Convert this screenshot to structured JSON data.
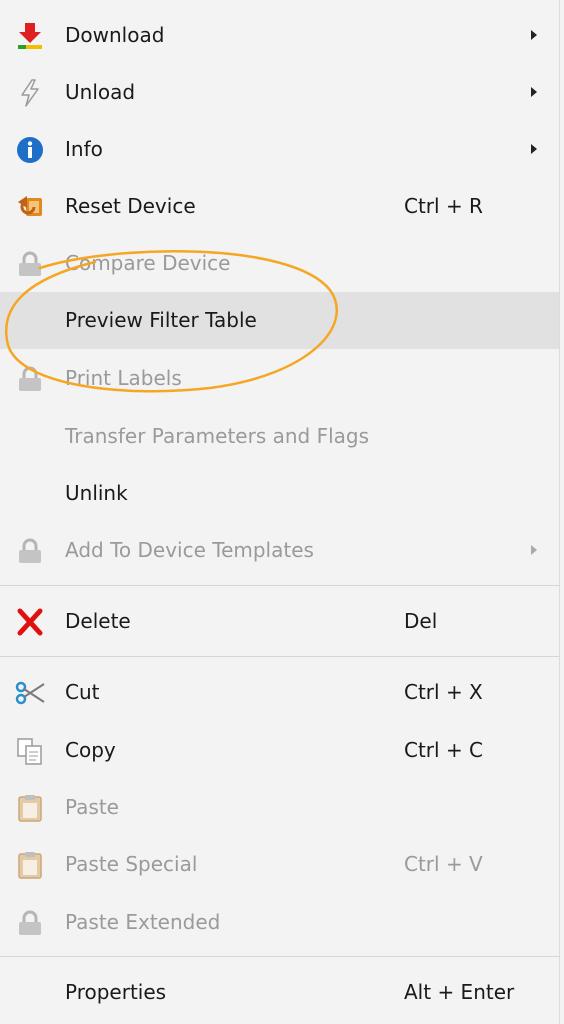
{
  "menu": {
    "items": [
      {
        "label": "Download",
        "shortcut": "",
        "icon": "download-icon",
        "submenu": true,
        "enabled": true
      },
      {
        "label": "Unload",
        "shortcut": "",
        "icon": "lightning-icon",
        "submenu": true,
        "enabled": true
      },
      {
        "label": "Info",
        "shortcut": "",
        "icon": "info-icon",
        "submenu": true,
        "enabled": true
      },
      {
        "label": "Reset Device",
        "shortcut": "Ctrl + R",
        "icon": "reset-icon",
        "submenu": false,
        "enabled": true
      },
      {
        "label": "Compare Device",
        "shortcut": "",
        "icon": "lock-icon",
        "submenu": false,
        "enabled": false
      },
      {
        "label": "Preview Filter Table",
        "shortcut": "",
        "icon": "",
        "submenu": false,
        "enabled": true,
        "hovered": true
      },
      {
        "label": "Print Labels",
        "shortcut": "",
        "icon": "lock-icon",
        "submenu": false,
        "enabled": false
      },
      {
        "label": "Transfer Parameters and Flags",
        "shortcut": "",
        "icon": "",
        "submenu": false,
        "enabled": false
      },
      {
        "label": "Unlink",
        "shortcut": "",
        "icon": "",
        "submenu": false,
        "enabled": true
      },
      {
        "label": "Add To Device Templates",
        "shortcut": "",
        "icon": "lock-icon",
        "submenu": true,
        "enabled": false
      },
      {
        "label": "Delete",
        "shortcut": "Del",
        "icon": "delete-x-icon",
        "submenu": false,
        "enabled": true
      },
      {
        "label": "Cut",
        "shortcut": "Ctrl + X",
        "icon": "scissors-icon",
        "submenu": false,
        "enabled": true
      },
      {
        "label": "Copy",
        "shortcut": "Ctrl + C",
        "icon": "copy-icon",
        "submenu": false,
        "enabled": true
      },
      {
        "label": "Paste",
        "shortcut": "",
        "icon": "clipboard-icon",
        "submenu": false,
        "enabled": false
      },
      {
        "label": "Paste Special",
        "shortcut": "Ctrl + V",
        "icon": "clipboard-icon",
        "submenu": false,
        "enabled": false
      },
      {
        "label": "Paste Extended",
        "shortcut": "",
        "icon": "lock-icon",
        "submenu": false,
        "enabled": false
      },
      {
        "label": "Properties",
        "shortcut": "Alt + Enter",
        "icon": "",
        "submenu": false,
        "enabled": true
      }
    ]
  },
  "colors": {
    "menu_background": "#f3f3f3",
    "hover_background": "#e1e1e1",
    "disabled_text": "#9a9a9a",
    "annotation_ellipse": "#f5a623"
  }
}
